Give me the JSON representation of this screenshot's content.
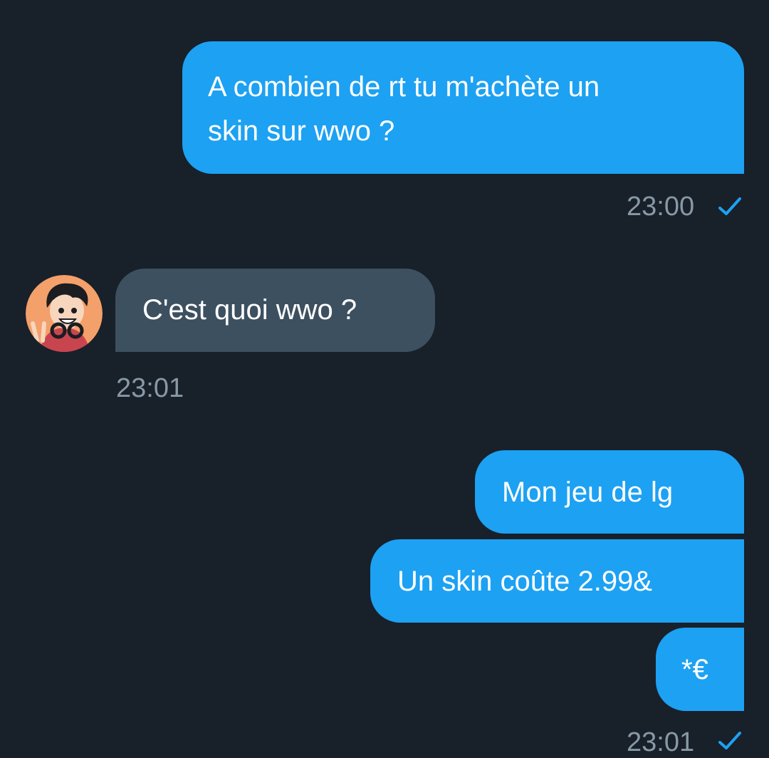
{
  "conversation": {
    "messages": [
      {
        "direction": "outgoing",
        "text": "A combien de rt tu m'achète un\nskin sur wwo ?"
      },
      {
        "direction": "incoming",
        "text": "C'est quoi wwo ?"
      },
      {
        "direction": "outgoing",
        "text": "Mon jeu de lg"
      },
      {
        "direction": "outgoing",
        "text": "Un skin coûte 2.99&"
      },
      {
        "direction": "outgoing",
        "text": "*€"
      }
    ],
    "timestamps": {
      "first_outgoing": "23:00",
      "incoming": "23:01",
      "last_outgoing": "23:01"
    }
  },
  "colors": {
    "background": "#18202a",
    "outgoing_bubble": "#1da1f2",
    "incoming_bubble": "#3d5060",
    "timestamp": "#8899a6",
    "read_check": "#1da1f2"
  },
  "icons": {
    "read_receipt": "checkmark-icon",
    "contact_avatar": "avatar-icon"
  }
}
